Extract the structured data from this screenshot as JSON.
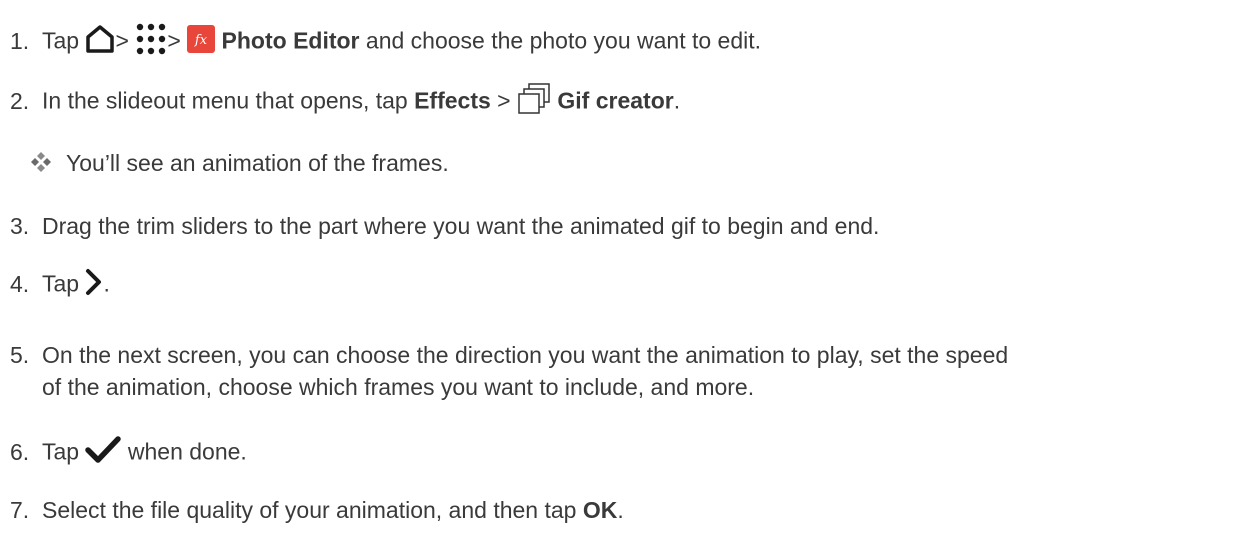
{
  "steps": [
    {
      "num": "1.",
      "tap": "Tap",
      "sep1": ">",
      "sep2": ">",
      "bold": "Photo Editor",
      "rest": " and choose the photo you want to edit."
    },
    {
      "num": "2.",
      "pre": "In the slideout menu that opens, tap ",
      "bold1": "Effects",
      "sep": " > ",
      "bold2": "Gif creator",
      "end": "."
    },
    {
      "num": "3.",
      "text": "Drag the trim sliders to the part where you want the animated gif to begin and end."
    },
    {
      "num": "4.",
      "tap": "Tap",
      "end": "."
    },
    {
      "num": "5.",
      "line1": "On the next screen, you can choose the direction you want the animation to play, set the speed",
      "line2": "of the animation, choose which frames you want to include, and more."
    },
    {
      "num": "6.",
      "tap": "Tap",
      "rest": " when done."
    },
    {
      "num": "7.",
      "pre": "Select the file quality of your animation, and then tap ",
      "bold": "OK",
      "end": "."
    }
  ],
  "note": {
    "text": "You’ll see an animation of the frames."
  },
  "icons": {
    "home": "home-icon",
    "apps": "apps-grid-icon",
    "photo_editor": "photo-editor-app-icon",
    "gif_creator": "gif-creator-icon",
    "next": "chevron-right-icon",
    "done": "checkmark-icon",
    "bullet": "diamond-bullet-icon"
  },
  "colors": {
    "text": "#3a3a3a",
    "photo_editor_bg": "#e8463a",
    "bullet": "#7a7a7a"
  }
}
